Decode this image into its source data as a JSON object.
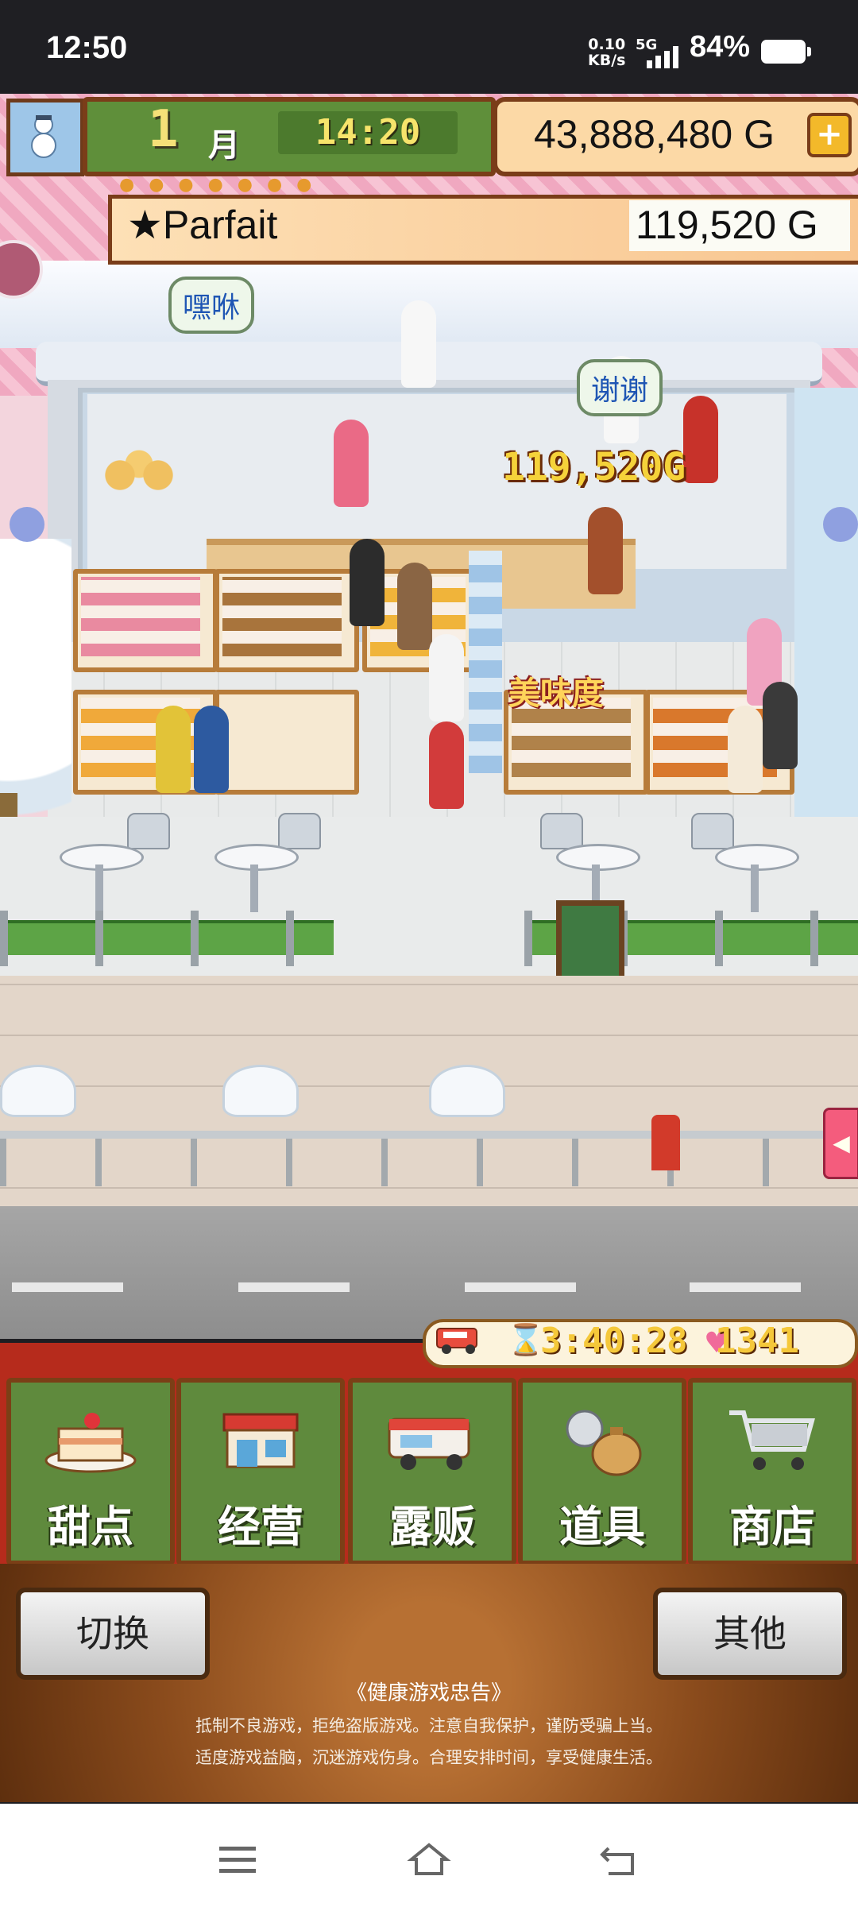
{
  "status_bar": {
    "time": "12:50",
    "net_speed_value": "0.10",
    "net_speed_unit": "KB/s",
    "network": "5G",
    "battery_pct": "84%"
  },
  "hud": {
    "month_number": "1",
    "month_label": "月",
    "clock": "14:20",
    "money": "43,888,480 G",
    "plus_label": "+",
    "shop_name": "★Parfait",
    "shop_value": "119,520 G"
  },
  "scene": {
    "bubble_left": "嘿咻",
    "bubble_right": "谢谢",
    "earn_popup": "119,520G",
    "taste_popup": "美味度"
  },
  "food_truck": {
    "timer": "3:40:28",
    "hearts": "1341"
  },
  "menu": {
    "items": [
      {
        "label": "甜点",
        "icon": "cake-icon"
      },
      {
        "label": "经营",
        "icon": "shop-icon"
      },
      {
        "label": "露贩",
        "icon": "food-truck-icon"
      },
      {
        "label": "道具",
        "icon": "item-bag-icon"
      },
      {
        "label": "商店",
        "icon": "shopping-cart-icon"
      }
    ]
  },
  "bottom": {
    "switch_label": "切换",
    "other_label": "其他",
    "notice_title": "《健康游戏忠告》",
    "notice_line1": "抵制不良游戏，拒绝盗版游戏。注意自我保护，谨防受骗上当。",
    "notice_line2": "适度游戏益脑，沉迷游戏伤身。合理安排时间，享受健康生活。"
  },
  "colors": {
    "menu_green": "#5f8a3d",
    "menu_red": "#b62b1c",
    "wood_brown": "#7b3f16",
    "gold_text": "#f5c83a"
  }
}
